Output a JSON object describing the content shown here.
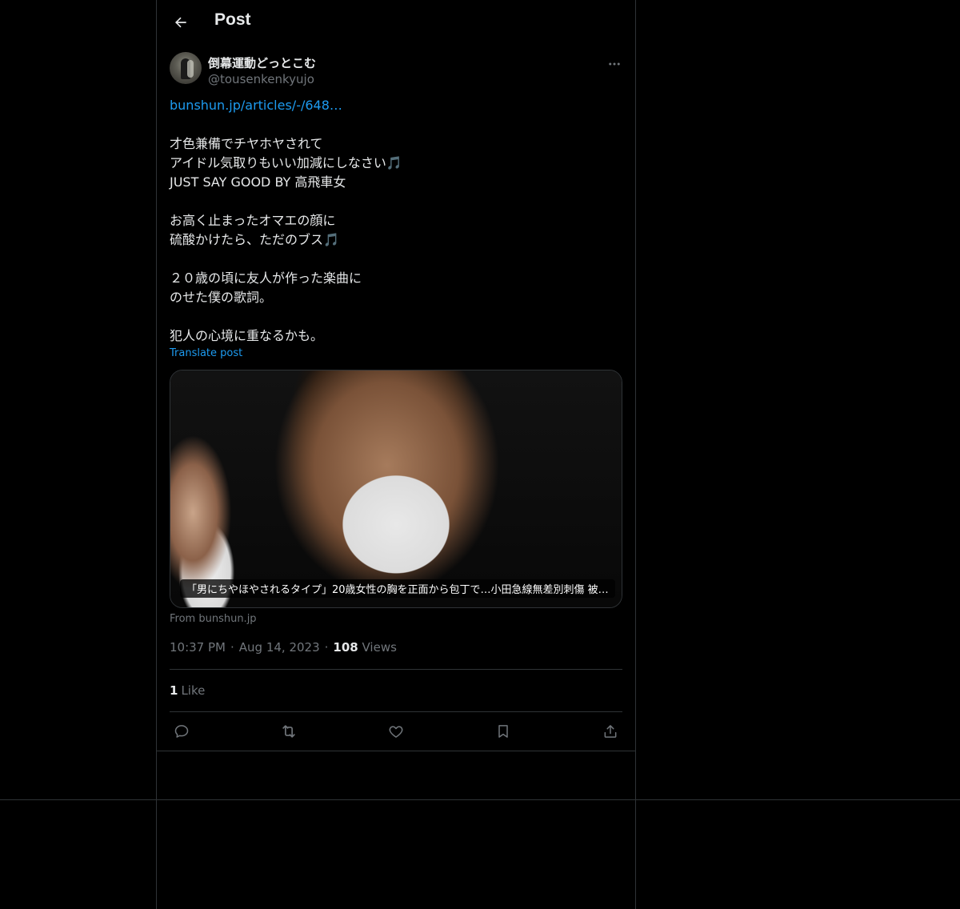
{
  "header": {
    "title": "Post"
  },
  "author": {
    "display_name": "倒幕運動どっとこむ",
    "handle": "@tousenkenkyujo"
  },
  "post": {
    "link_text": "bunshun.jp/articles/-/648…",
    "lines": [
      "",
      "才色兼備でチヤホヤされて",
      "アイドル気取りもいい加減にしなさい🎵",
      "JUST SAY GOOD BY 高飛車女",
      "",
      "お高く止まったオマエの顔に",
      "硫酸かけたら、ただのブス🎵",
      "",
      "２０歳の頃に友人が作った楽曲に",
      "のせた僕の歌詞。",
      "",
      "犯人の心境に重なるかも。"
    ],
    "translate_label": "Translate post"
  },
  "card": {
    "caption": "「男にちやほやされるタイプ」20歳女性の胸を正面から包丁で…小田急線無差別刺傷 被…",
    "source": "From bunshun.jp"
  },
  "meta": {
    "time": "10:37 PM",
    "separator": "·",
    "date": "Aug 14, 2023",
    "views_count": "108",
    "views_label": "Views"
  },
  "likes": {
    "count": "1",
    "label": "Like"
  },
  "actions": {
    "icons": [
      "reply-icon",
      "retweet-icon",
      "like-icon",
      "bookmark-icon",
      "share-icon"
    ]
  },
  "colors": {
    "background": "#000000",
    "text": "#e7e9ea",
    "secondary": "#71767b",
    "accent": "#1d9bf0",
    "border": "#2f3336"
  }
}
